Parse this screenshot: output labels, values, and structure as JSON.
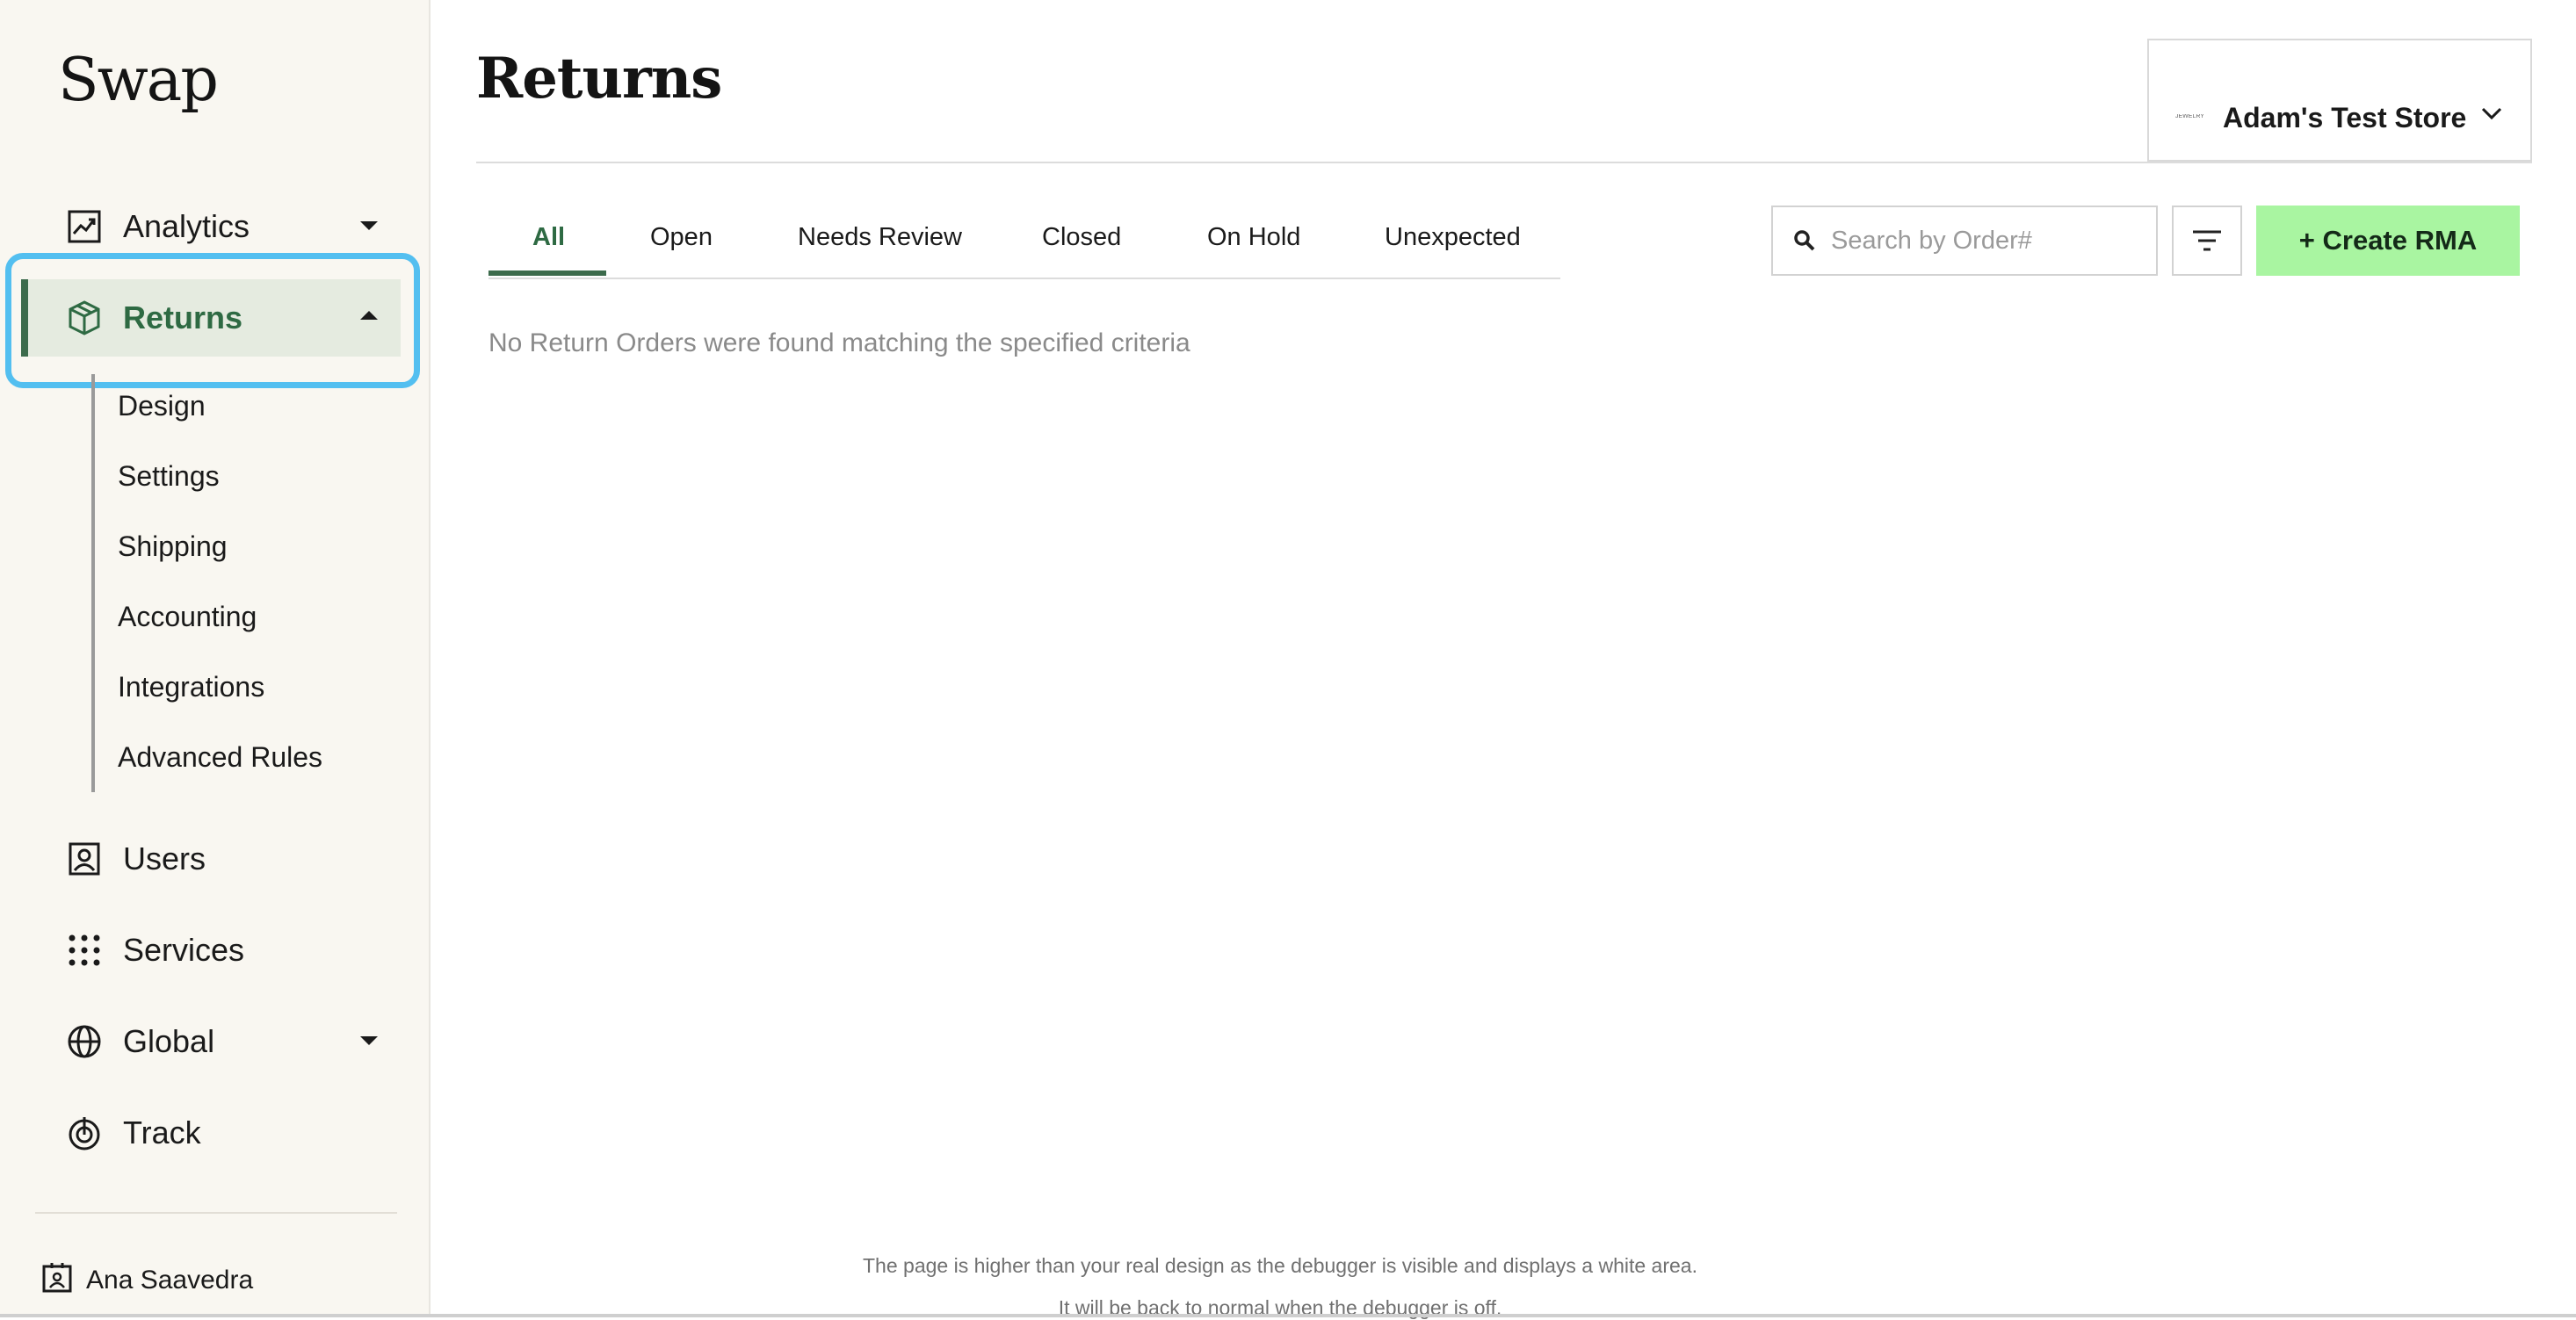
{
  "brand": {
    "logo_text": "Swap"
  },
  "sidebar": {
    "items": [
      {
        "label": "Analytics",
        "icon": "analytics-icon"
      },
      {
        "label": "Returns",
        "icon": "package-icon",
        "active": true,
        "children": [
          "Design",
          "Settings",
          "Shipping",
          "Accounting",
          "Integrations",
          "Advanced Rules"
        ]
      },
      {
        "label": "Users",
        "icon": "users-icon"
      },
      {
        "label": "Services",
        "icon": "grid-icon"
      },
      {
        "label": "Global",
        "icon": "globe-icon"
      },
      {
        "label": "Track",
        "icon": "track-icon"
      }
    ],
    "user_name": "Ana Saavedra"
  },
  "header": {
    "title": "Returns",
    "store_name": "Adam's Test Store",
    "store_logo_text": "JEWELRY"
  },
  "tabs": [
    "All",
    "Open",
    "Needs Review",
    "Closed",
    "On Hold",
    "Unexpected"
  ],
  "toolbar": {
    "search_placeholder": "Search by Order#",
    "create_label": "+ Create RMA"
  },
  "main": {
    "empty_message": "No Return Orders were found matching the specified criteria"
  },
  "debugger": {
    "line1": "The page is higher than your real design as the debugger is visible and displays a white area.",
    "line2": "It will be back to normal when the debugger is off."
  },
  "colors": {
    "accent": "#3c6b4c",
    "create_button": "#a9f5a1",
    "highlight": "#53bff0",
    "sidebar_bg": "#f9f7f1"
  }
}
